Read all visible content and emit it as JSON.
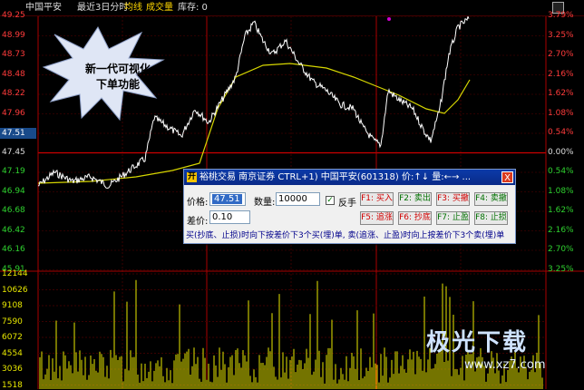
{
  "topbar": {
    "security": "中国平安",
    "period": "最近3日分时",
    "avg_label": "均线",
    "volume_label": "成交量",
    "inventory_label": "库存: 0"
  },
  "price_axis_left": [
    "49.25",
    "48.99",
    "48.73",
    "48.48",
    "48.22",
    "47.96",
    "47.71",
    "47.45",
    "47.19",
    "46.94",
    "46.68",
    "46.42",
    "46.16",
    "45.91"
  ],
  "price_axis_right": [
    "3.79%",
    "3.25%",
    "2.70%",
    "2.16%",
    "1.62%",
    "1.08%",
    "0.54%",
    "0.00%",
    "0.54%",
    "1.08%",
    "1.62%",
    "2.16%",
    "2.70%",
    "3.25%"
  ],
  "volume_axis_left": [
    "12144",
    "10626",
    "9108",
    "7590",
    "6072",
    "4554",
    "3036",
    "1518"
  ],
  "current_price_badge": "47.51",
  "callout": {
    "line1": "新一代可视化",
    "line2": "下单功能"
  },
  "order_panel": {
    "logo": "开",
    "title": "裕桃交易 南京证券      CTRL+1) 中国平安(601318) 价:↑↓ 量:←→ ...",
    "close_label": "X",
    "price_label": "价格:",
    "price_value": "47.51",
    "qty_label": "数量:",
    "qty_value": "10000",
    "reverse_label": "反手",
    "reverse_checked": "✓",
    "diff_label": "差价:",
    "diff_value": "0.10",
    "buttons": [
      {
        "label": "F1: 买入",
        "color": "#d00000"
      },
      {
        "label": "F2: 卖出",
        "color": "#007000"
      },
      {
        "label": "F3: 买撤",
        "color": "#d00000"
      },
      {
        "label": "F4: 卖撤",
        "color": "#007000"
      },
      {
        "label": "F5: 追涨",
        "color": "#d00000"
      },
      {
        "label": "F6: 抄底",
        "color": "#d00000"
      },
      {
        "label": "F7: 止盈",
        "color": "#007000"
      },
      {
        "label": "F8: 止损",
        "color": "#007000"
      }
    ],
    "note": "买(抄底、止损)时向下按差价下3个买(埋)单, 卖(追涨、止盈)时向上按差价下3个卖(埋)单"
  },
  "watermark": {
    "main": "极光下载",
    "url": "www.xz7.com"
  },
  "colors": {
    "price_line": "#ffffff",
    "avg_line": "#d6d600",
    "grid": "#7a0000",
    "axis_up": "#ff3b3b",
    "axis_down": "#2fd12f",
    "volume": "#e8e800"
  }
}
